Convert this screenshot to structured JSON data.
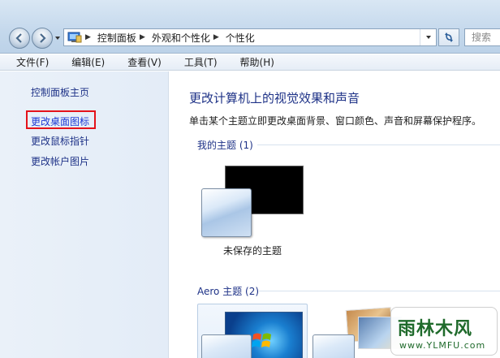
{
  "window": {
    "breadcrumbs": [
      "控制面板",
      "外观和个性化",
      "个性化"
    ],
    "search_placeholder": "搜索"
  },
  "menu": {
    "items": [
      "文件(F)",
      "编辑(E)",
      "查看(V)",
      "工具(T)",
      "帮助(H)"
    ]
  },
  "sidebar": {
    "home": "控制面板主页",
    "items": [
      "更改桌面图标",
      "更改鼠标指针",
      "更改帐户图片"
    ]
  },
  "main": {
    "title": "更改计算机上的视觉效果和声音",
    "description": "单击某个主题立即更改桌面背景、窗口颜色、声音和屏幕保护程序。",
    "my_themes_label": "我的主题 (1)",
    "unsaved_theme": "未保存的主题",
    "aero_themes_label": "Aero 主题 (2)"
  },
  "watermark": {
    "text": "雨林木风",
    "url": "www.YLMFU.com"
  },
  "colors": {
    "highlight_box": "#e4121a",
    "link": "#1e3287"
  }
}
